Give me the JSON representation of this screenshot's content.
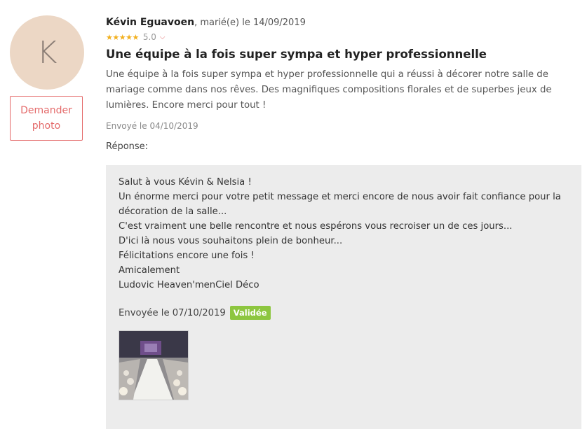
{
  "avatar": {
    "initial": "K"
  },
  "ask_photo": {
    "label": "Demander photo"
  },
  "review": {
    "author": "Kévin Eguavoen",
    "meta": ", marié(e) le 14/09/2019",
    "rating_value": "5.0",
    "rating_stars": 5,
    "title": "Une équipe à la fois super sympa et hyper professionnelle",
    "body": "Une équipe à la fois super sympa et hyper professionnelle qui a réussi à décorer notre salle de mariage comme dans nos rêves. Des magnifiques compositions florales et de superbes jeux de lumières. Encore merci pour tout !",
    "sent": "Envoyé le 04/10/2019"
  },
  "reply": {
    "label": "Réponse:",
    "lines": [
      "Salut à vous Kévin & Nelsia !",
      "Un énorme merci pour votre petit message et merci encore de nous avoir fait confiance pour la",
      "décoration de la salle...",
      "C'est vraiment une belle rencontre et nous espérons vous recroiser un de ces jours...",
      "D'ici là nous vous souhaitons plein de bonheur...",
      "Félicitations encore une fois !",
      "Amicalement",
      "Ludovic Heaven'menCiel Déco"
    ],
    "sent": "Envoyée le 07/10/2019",
    "status_badge": "Validée"
  },
  "colors": {
    "accent": "#e46a6a",
    "star": "#f2b01e",
    "badge": "#8dc63f",
    "reply_bg": "#ececec"
  },
  "icons": {
    "rating": "star-icon",
    "expand": "chevron-down-icon"
  }
}
